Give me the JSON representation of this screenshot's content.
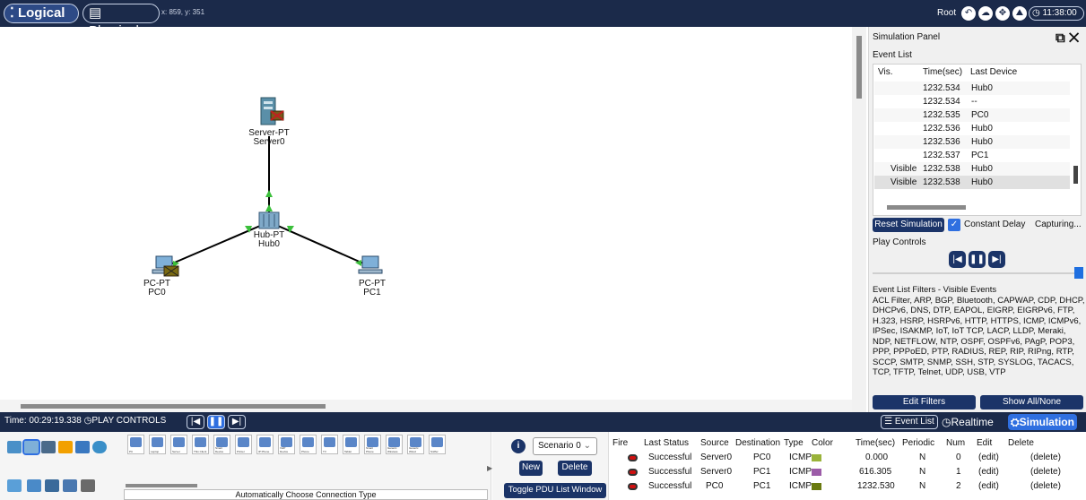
{
  "topbar": {
    "logical": "Logical",
    "physical": "Physical",
    "coords": "x: 859, y: 351",
    "root": "Root",
    "clock": "11:38:00"
  },
  "devices": {
    "server": {
      "model": "Server-PT",
      "name": "Server0"
    },
    "hub": {
      "model": "Hub-PT",
      "name": "Hub0"
    },
    "pc0": {
      "model": "PC-PT",
      "name": "PC0"
    },
    "pc1": {
      "model": "PC-PT",
      "name": "PC1"
    }
  },
  "sim_panel": {
    "title": "Simulation Panel",
    "event_list_label": "Event List",
    "headers": {
      "vis": "Vis.",
      "time": "Time(sec)",
      "last_device": "Last Device"
    },
    "events": [
      {
        "vis": "",
        "time": "1232.534",
        "device": "Hub0"
      },
      {
        "vis": "",
        "time": "1232.534",
        "device": "--"
      },
      {
        "vis": "",
        "time": "1232.535",
        "device": "PC0"
      },
      {
        "vis": "",
        "time": "1232.536",
        "device": "Hub0"
      },
      {
        "vis": "",
        "time": "1232.536",
        "device": "Hub0"
      },
      {
        "vis": "",
        "time": "1232.537",
        "device": "PC1"
      },
      {
        "vis": "Visible",
        "time": "1232.538",
        "device": "Hub0"
      },
      {
        "vis": "Visible",
        "time": "1232.538",
        "device": "Hub0"
      }
    ],
    "reset": "Reset Simulation",
    "constant_delay": "Constant Delay",
    "capturing": "Capturing...",
    "play_controls": "Play Controls",
    "filters_title": "Event List Filters - Visible Events",
    "filters": "ACL Filter, ARP, BGP, Bluetooth, CAPWAP, CDP, DHCP, DHCPv6, DNS, DTP, EAPOL, EIGRP, EIGRPv6, FTP, H.323, HSRP, HSRPv6, HTTP, HTTPS, ICMP, ICMPv6, IPSec, ISAKMP, IoT, IoT TCP, LACP, LLDP, Meraki, NDP, NETFLOW, NTP, OSPF, OSPFv6, PAgP, POP3, PPP, PPPoED, PTP, RADIUS, REP, RIP, RIPng, RTP, SCCP, SMTP, SNMP, SSH, STP, SYSLOG, TACACS, TCP, TFTP, Telnet, UDP, USB, VTP",
    "edit_filters": "Edit Filters",
    "show_all": "Show All/None"
  },
  "statusbar": {
    "time": "Time: 00:29:19.338",
    "play_controls": "PLAY CONTROLS",
    "event_list": "Event List",
    "realtime": "Realtime",
    "simulation": "Simulation"
  },
  "device_types": [
    "PC",
    "Laptop",
    "Server",
    "Thin Client",
    "Smart Device",
    "Printer",
    "IP Phone",
    "VoIP Device",
    "Phone",
    "TV",
    "Tablet",
    "Smart Phone",
    "Generic Wireless",
    "Generic Wired",
    "Sniffer"
  ],
  "connection_type": "Automatically Choose Connection Type",
  "scenario": {
    "label": "Scenario 0",
    "new": "New",
    "delete": "Delete",
    "toggle": "Toggle PDU List Window"
  },
  "pdu": {
    "headers": [
      "Fire",
      "Last Status",
      "Source",
      "Destination",
      "Type",
      "Color",
      "Time(sec)",
      "Periodic",
      "Num",
      "Edit",
      "Delete"
    ],
    "rows": [
      {
        "status": "Successful",
        "source": "Server0",
        "dest": "PC0",
        "type": "ICMP",
        "color": "#9ab33a",
        "time": "0.000",
        "periodic": "N",
        "num": "0",
        "edit": "(edit)",
        "delete": "(delete)"
      },
      {
        "status": "Successful",
        "source": "Server0",
        "dest": "PC1",
        "type": "ICMP",
        "color": "#9c5ca8",
        "time": "616.305",
        "periodic": "N",
        "num": "1",
        "edit": "(edit)",
        "delete": "(delete)"
      },
      {
        "status": "Successful",
        "source": "PC0",
        "dest": "PC1",
        "type": "ICMP",
        "color": "#6a7a10",
        "time": "1232.530",
        "periodic": "N",
        "num": "2",
        "edit": "(edit)",
        "delete": "(delete)"
      }
    ]
  }
}
